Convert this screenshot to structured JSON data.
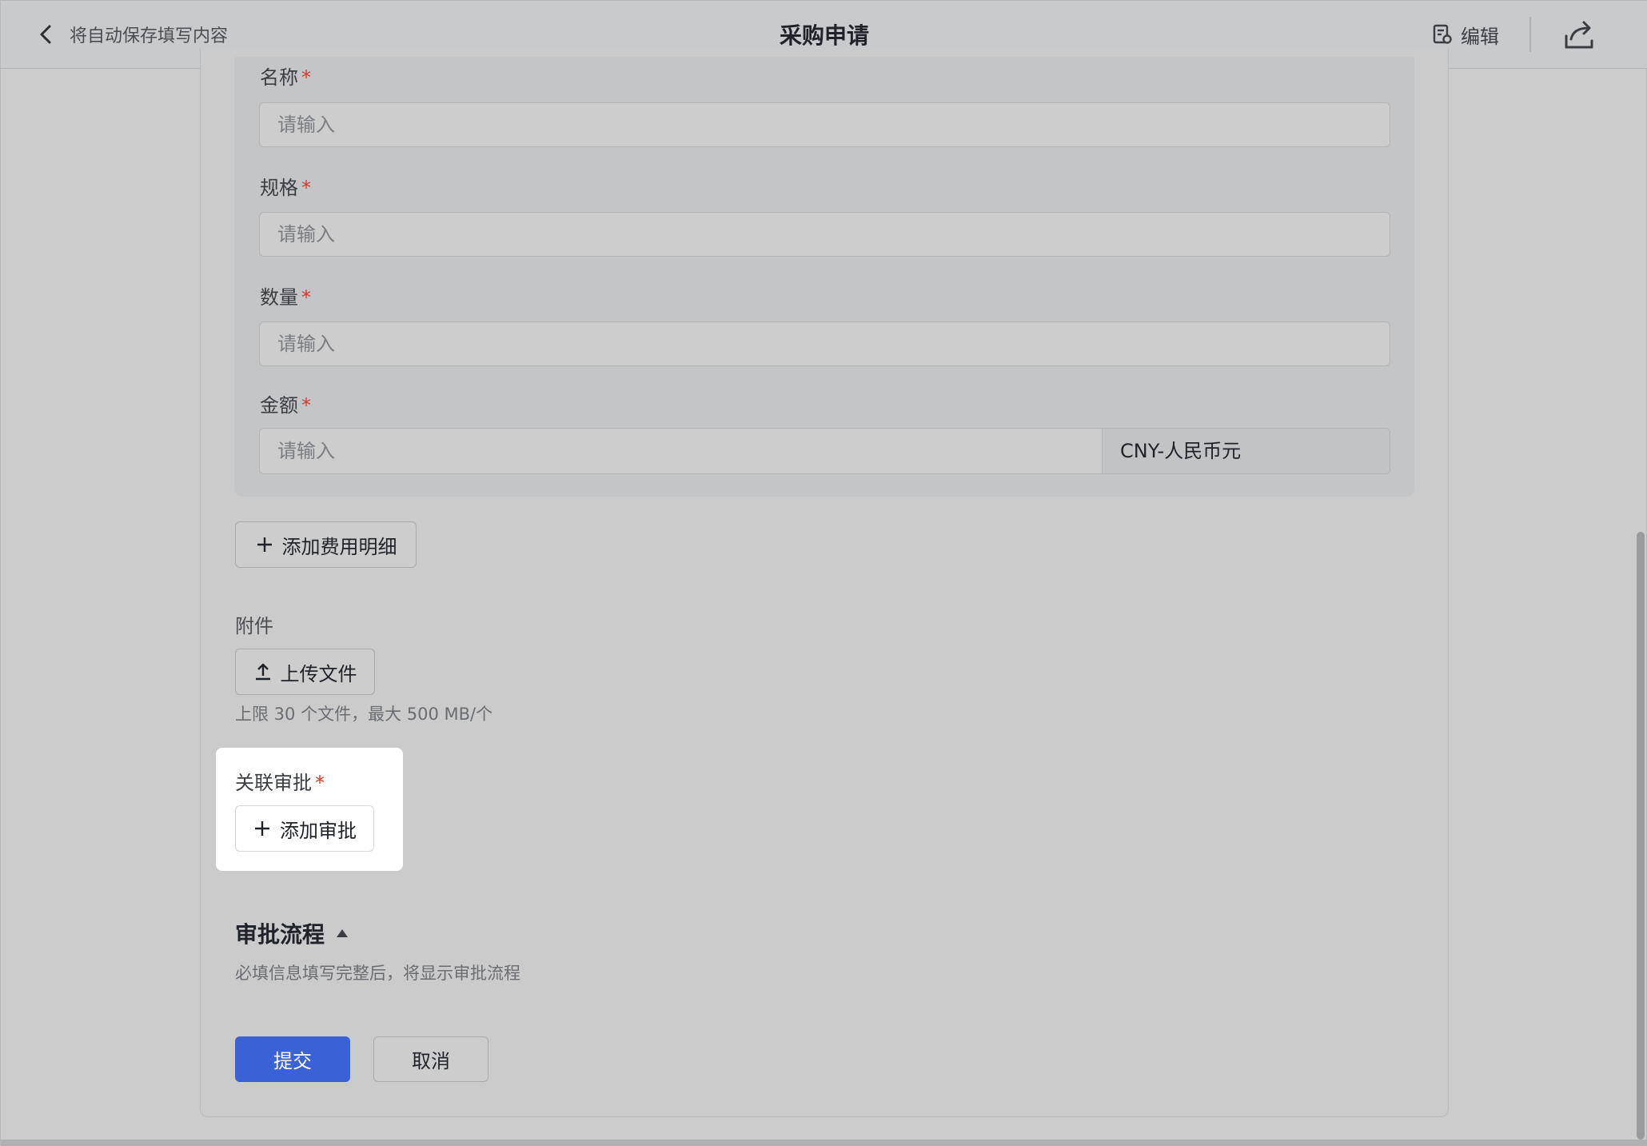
{
  "header": {
    "back_label": "将自动保存填写内容",
    "title": "采购申请",
    "edit_label": "编辑"
  },
  "detail": {
    "fields": [
      {
        "label": "名称",
        "required_mark": "*",
        "placeholder": "请输入"
      },
      {
        "label": "规格",
        "required_mark": "*",
        "placeholder": "请输入"
      },
      {
        "label": "数量",
        "required_mark": "*",
        "placeholder": "请输入"
      },
      {
        "label": "金额",
        "required_mark": "*",
        "placeholder": "请输入",
        "currency": "CNY-人民币元"
      }
    ],
    "add_detail_label": "添加费用明细"
  },
  "attachment": {
    "label": "附件",
    "upload_label": "上传文件",
    "hint": "上限 30 个文件，最大 500 MB/个"
  },
  "related_approval": {
    "label": "关联审批",
    "required_mark": "*",
    "add_label": "添加审批"
  },
  "approval_flow": {
    "title": "审批流程",
    "hint": "必填信息填写完整后，将显示审批流程"
  },
  "actions": {
    "submit_label": "提交",
    "cancel_label": "取消"
  },
  "colors": {
    "primary": "#3a61d6",
    "required": "#d43a2f",
    "overlay_background": "#cccccc"
  }
}
